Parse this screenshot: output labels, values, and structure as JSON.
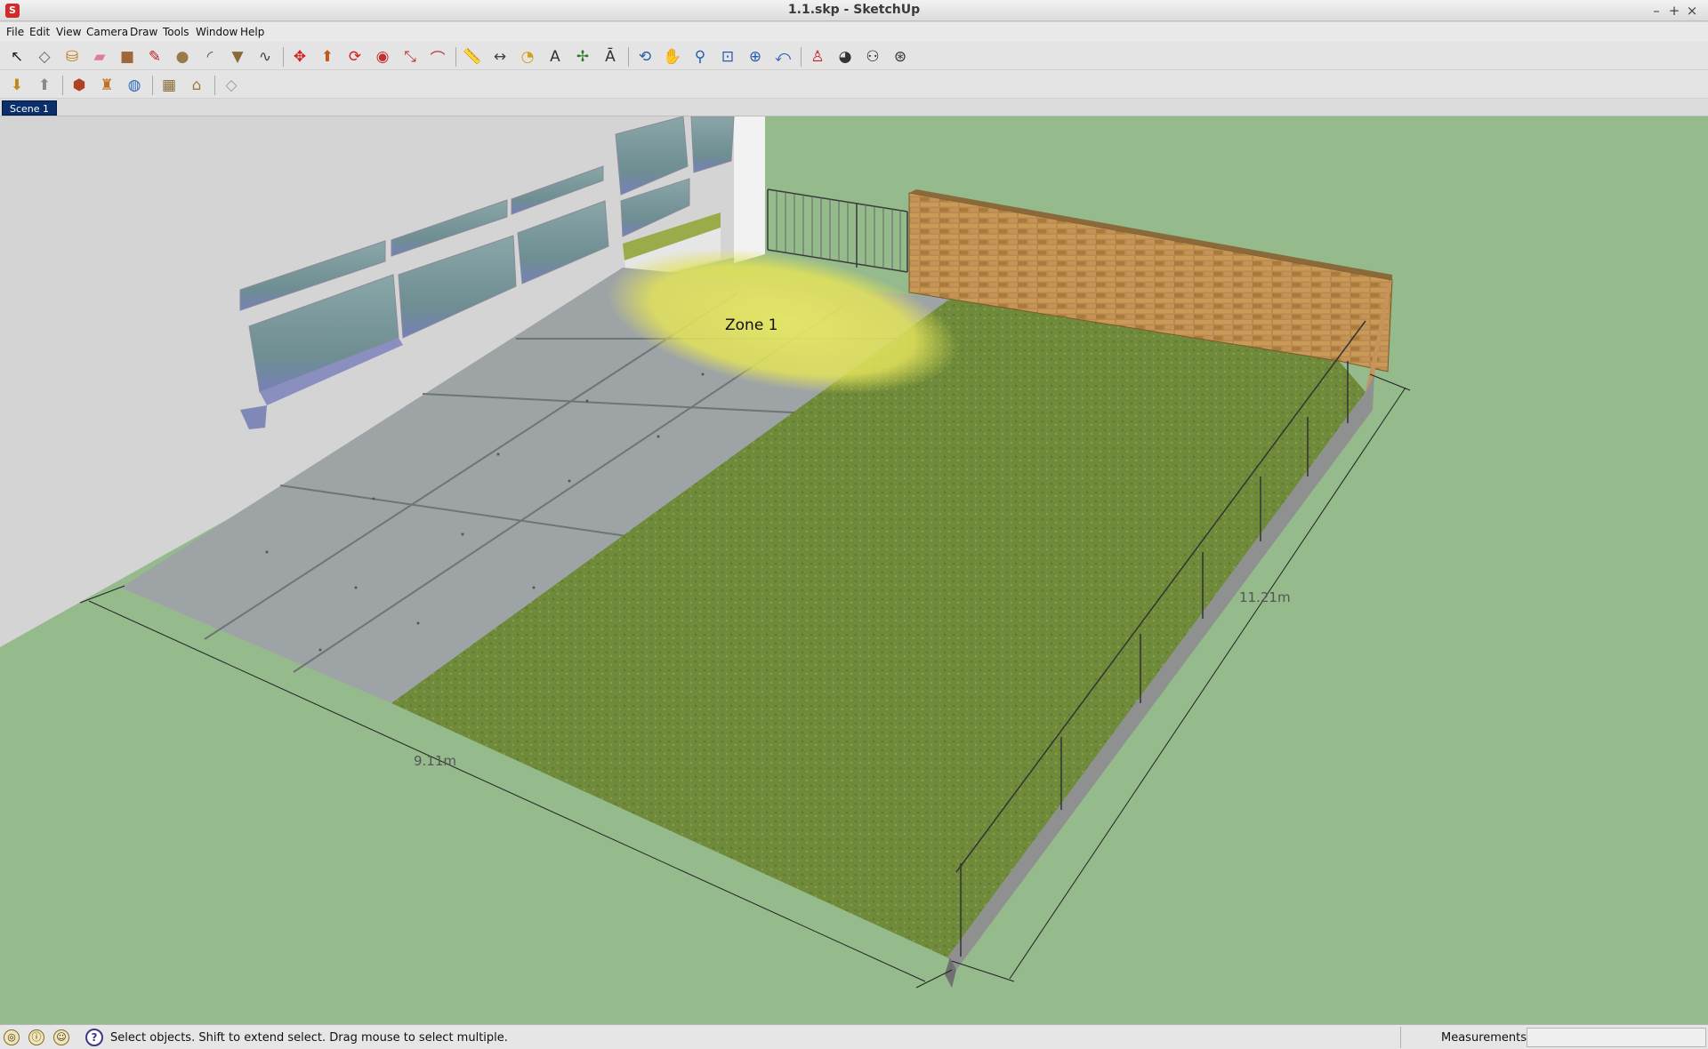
{
  "window": {
    "title": "1.1.skp - SketchUp",
    "app_icon": "sketchup-logo-icon",
    "minimize": "–",
    "maximize": "+",
    "close": "×"
  },
  "menu": {
    "items": [
      {
        "label": "File",
        "name": "menu-file"
      },
      {
        "label": "Edit",
        "name": "menu-edit"
      },
      {
        "label": "View",
        "name": "menu-view"
      },
      {
        "label": "Camera",
        "name": "menu-camera"
      },
      {
        "label": "Draw",
        "name": "menu-draw"
      },
      {
        "label": "Tools",
        "name": "menu-tools"
      },
      {
        "label": "Window",
        "name": "menu-window"
      },
      {
        "label": "Help",
        "name": "menu-help"
      }
    ]
  },
  "toolbar_main": [
    {
      "icon": "select-arrow-icon",
      "glyph": "↖",
      "color": "#222222"
    },
    {
      "icon": "make-component-icon",
      "glyph": "◇",
      "color": "#666666"
    },
    {
      "icon": "paint-bucket-icon",
      "glyph": "⛁",
      "color": "#c0781a"
    },
    {
      "icon": "eraser-icon",
      "glyph": "▰",
      "color": "#e07b9a"
    },
    {
      "icon": "rectangle-icon",
      "glyph": "■",
      "color": "#a0683a"
    },
    {
      "icon": "line-pencil-icon",
      "glyph": "✎",
      "color": "#c02020"
    },
    {
      "icon": "circle-icon",
      "glyph": "●",
      "color": "#9a7a4a"
    },
    {
      "icon": "arc-icon",
      "glyph": "◜",
      "color": "#555555"
    },
    {
      "icon": "polygon-icon",
      "glyph": "▼",
      "color": "#8a6a3a"
    },
    {
      "icon": "freehand-icon",
      "glyph": "∿",
      "color": "#444444"
    },
    {
      "icon": "move-icon",
      "glyph": "✥",
      "color": "#d02020"
    },
    {
      "icon": "push-pull-icon",
      "glyph": "⬆",
      "color": "#c05a1a"
    },
    {
      "icon": "rotate-icon",
      "glyph": "⟳",
      "color": "#d02020"
    },
    {
      "icon": "follow-me-icon",
      "glyph": "◉",
      "color": "#c03030"
    },
    {
      "icon": "scale-icon",
      "glyph": "⤡",
      "color": "#c03030"
    },
    {
      "icon": "offset-icon",
      "glyph": "⌒",
      "color": "#c03030"
    },
    {
      "icon": "tape-measure-icon",
      "glyph": "📏",
      "color": "#c08a1a"
    },
    {
      "icon": "dimension-icon",
      "glyph": "↔",
      "color": "#444444"
    },
    {
      "icon": "protractor-icon",
      "glyph": "◔",
      "color": "#d0a020"
    },
    {
      "icon": "text-icon",
      "glyph": "A",
      "color": "#333333"
    },
    {
      "icon": "axes-icon",
      "glyph": "✢",
      "color": "#2a7a2a"
    },
    {
      "icon": "3d-text-icon",
      "glyph": "Ā",
      "color": "#333333"
    },
    {
      "icon": "orbit-icon",
      "glyph": "⟲",
      "color": "#2a5ab0"
    },
    {
      "icon": "pan-hand-icon",
      "glyph": "✋",
      "color": "#555555"
    },
    {
      "icon": "zoom-icon",
      "glyph": "⚲",
      "color": "#2a5ab0"
    },
    {
      "icon": "zoom-window-icon",
      "glyph": "⊡",
      "color": "#2a5ab0"
    },
    {
      "icon": "zoom-extents-icon",
      "glyph": "⊕",
      "color": "#2a5ab0"
    },
    {
      "icon": "previous-view-icon",
      "glyph": "⤺",
      "color": "#2a5ab0"
    },
    {
      "icon": "position-camera-icon",
      "glyph": "♙",
      "color": "#c02020"
    },
    {
      "icon": "look-around-icon",
      "glyph": "◕",
      "color": "#333333"
    },
    {
      "icon": "walk-icon",
      "glyph": "⚇",
      "color": "#222222"
    },
    {
      "icon": "section-plane-icon",
      "glyph": "⊛",
      "color": "#333333"
    }
  ],
  "toolbar_secondary": [
    {
      "icon": "get-models-icon",
      "glyph": "⬇",
      "color": "#c08a1a"
    },
    {
      "icon": "share-model-icon",
      "glyph": "⬆",
      "color": "#888888"
    },
    {
      "icon": "share-component-icon",
      "glyph": "⬢",
      "color": "#b04020"
    },
    {
      "icon": "extension-warehouse-icon",
      "glyph": "♜",
      "color": "#c07020"
    },
    {
      "icon": "google-earth-icon",
      "glyph": "◍",
      "color": "#2a6ac0"
    },
    {
      "icon": "photo-textures-icon",
      "glyph": "▦",
      "color": "#8a6a3a"
    },
    {
      "icon": "add-location-icon",
      "glyph": "⌂",
      "color": "#a07a3a"
    },
    {
      "icon": "toggle-terrain-icon",
      "glyph": "◇",
      "color": "#999999"
    }
  ],
  "scenes": {
    "tabs": [
      "Scene 1"
    ]
  },
  "viewport": {
    "sky_color": "#95ba8c",
    "ground_color": "#95ba8c",
    "zone_label": "Zone 1",
    "dimensions": {
      "width_label": "9.11m",
      "length_label": "11.21m"
    }
  },
  "status": {
    "hint": "Select objects. Shift to extend select. Drag mouse to select multiple.",
    "geo_icon": "geo-location-icon",
    "credits_icon": "credits-icon",
    "user_icon": "user-account-icon",
    "help_icon": "help-icon",
    "help_glyph": "?",
    "measurements_label": "Measurements",
    "measurements_value": ""
  }
}
